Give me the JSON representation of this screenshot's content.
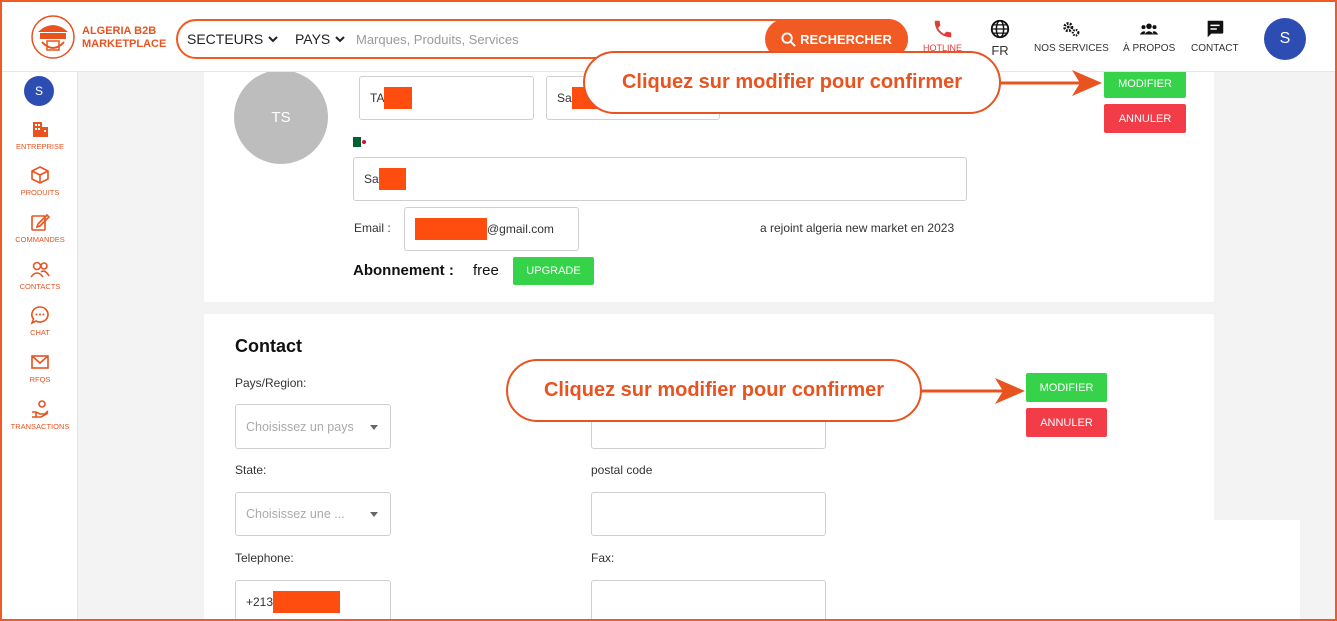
{
  "header": {
    "brand_line1": "ALGERIA B2B",
    "brand_line2": "MARKETPLACE",
    "sectors_label": "SECTEURS",
    "countries_label": "PAYS",
    "search_placeholder": "Marques, Produits, Services",
    "search_button": "RECHERCHER",
    "nav": {
      "hotline": "HOTLINE",
      "language": "FR",
      "services": "NOS SERVICES",
      "about": "À PROPOS",
      "contact": "CONTACT"
    },
    "avatar_initial": "S"
  },
  "sidebar": {
    "avatar_initial": "S",
    "items": [
      "ENTREPRISE",
      "PRODUITS",
      "COMMANDES",
      "CONTACTS",
      "CHAT",
      "RFQS",
      "TRANSACTIONS"
    ]
  },
  "profile": {
    "initials": "TS",
    "first_name": "TA",
    "last_name": "Sa",
    "company": "Sa",
    "email_label": "Email :",
    "email_suffix": "@gmail.com",
    "joined_text": "a rejoint algeria new market en 2023",
    "subscription_label": "Abonnement :",
    "subscription_value": "free",
    "upgrade_button": "UPGRADE",
    "modify_button": "MODIFIER",
    "cancel_button": "ANNULER"
  },
  "contact": {
    "title": "Contact",
    "country_label": "Pays/Region:",
    "country_placeholder": "Choisissez un pays",
    "state_label": "State:",
    "state_placeholder": "Choisissez une ...",
    "postal_label": "postal code",
    "phone_label": "Telephone:",
    "phone_prefix": "+213",
    "fax_label": "Fax:",
    "modify_button": "MODIFIER",
    "cancel_button": "ANNULER"
  },
  "annotations": {
    "callout_top": "Cliquez sur modifier pour confirmer",
    "callout_bottom": "Cliquez sur modifier pour confirmer"
  },
  "colors": {
    "accent": "#f15a22",
    "avatar": "#2e4db3",
    "green": "#36d34a",
    "red": "#f23c48",
    "redaction": "#ff4d0f"
  }
}
